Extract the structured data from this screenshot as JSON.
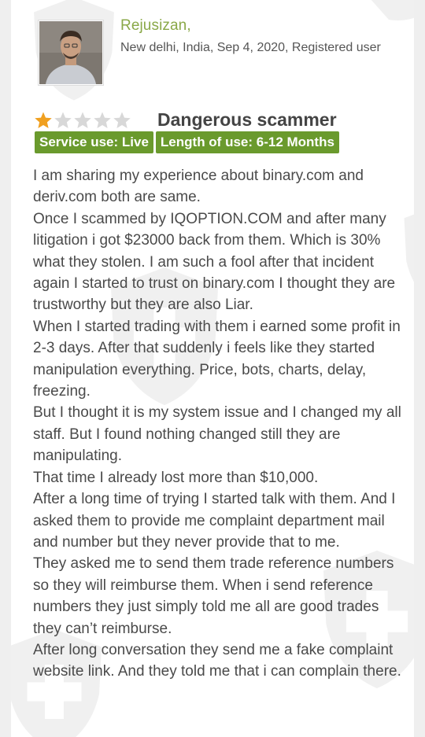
{
  "reviewer": {
    "name": "Rejusizan,",
    "meta": "New delhi, India, Sep 4, 2020, Registered user"
  },
  "review": {
    "title": "Dangerous scammer",
    "rating": 1,
    "rating_max": 5,
    "badges": [
      {
        "label": "Service use: Live"
      },
      {
        "label": "Length of use: 6-12 Months"
      }
    ],
    "paragraphs": [
      "I am sharing my experience about binary.com and deriv.com both are same.",
      "Once I scammed by IQOPTION.COM and after many litigation i got $23000 back from them. Which is 30% what they stolen. I am such a fool after that incident again I started to trust on binary.com I thought they are trustworthy but they are also Liar.",
      "When I started trading with them i earned some profit in 2-3 days. After that suddenly i feels like they started manipulation everything. Price, bots, charts, delay, freezing.",
      "But I thought it is my system issue and I changed my all staff. But I found nothing changed still they are manipulating.",
      "That time I already lost more than $10,000.",
      "After a long time of trying I started talk with them. And I asked them to provide me complaint department mail and number but they never provide that to me.",
      "They asked me to send them trade reference numbers so they will reimburse them. When i send reference numbers they just simply told me all are good trades they can’t reimburse.",
      "After long conversation they send me a fake complaint website link. And they told me that i can complain there."
    ]
  },
  "colors": {
    "username": "#8aa848",
    "badge_bg": "#6a9a2d",
    "star_filled": "#f0a020",
    "star_empty": "#d8d8d8"
  }
}
